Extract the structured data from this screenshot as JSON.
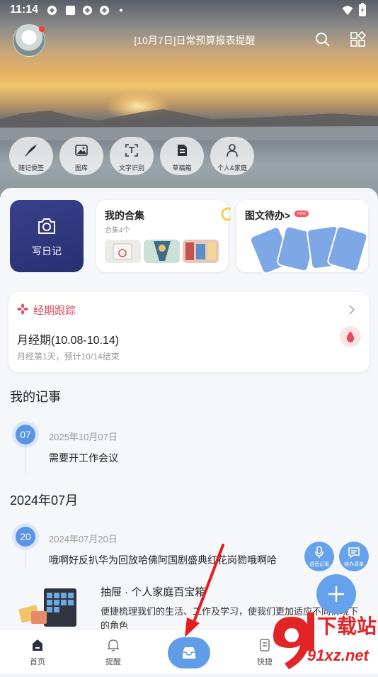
{
  "status": {
    "time": "11:14"
  },
  "header": {
    "title": "[10月7日]日常预算报表提醒"
  },
  "quick_actions": [
    {
      "label": "随记便签",
      "icon": "quill-icon"
    },
    {
      "label": "图库",
      "icon": "image-icon"
    },
    {
      "label": "文字识别",
      "icon": "scan-text-icon"
    },
    {
      "label": "草稿箱",
      "icon": "draft-box-icon"
    },
    {
      "label": "个人&家庭",
      "icon": "person-icon"
    }
  ],
  "write_diary": {
    "label": "写日记"
  },
  "collection": {
    "title": "我的合集",
    "count": "合集4个"
  },
  "todo": {
    "title": "图文待办>",
    "badge": "new"
  },
  "period": {
    "title": "经期跟踪",
    "main": "月经期(10.08-10.14)",
    "sub": "月经第1天，预计10/14结束"
  },
  "my_notes": {
    "title": "我的记事",
    "entries": [
      {
        "day": "07",
        "date": "2025年10月07日",
        "text": "需要开工作会议"
      }
    ]
  },
  "month_group": {
    "title": "2024年07月",
    "entries": [
      {
        "day": "20",
        "date": "2024年07月20日",
        "text": "哦啊好反扒华为回放哈佛阿国剧盛典红花岗勠哦啊哈"
      }
    ]
  },
  "book": {
    "title": "抽屉 · 个人家庭百宝箱",
    "desc_line1": "便捷梳理我们的生活、工作及学习，使我们更加适应不同情境下",
    "desc_line2": "的角色"
  },
  "fabs": {
    "voice": "语音记事",
    "todo": "待办清单"
  },
  "bottom_nav": [
    {
      "label": "首页"
    },
    {
      "label": "提醒"
    },
    {
      "label": "快捷"
    }
  ],
  "watermark": {
    "brand": "下载站",
    "url": "91xz.net"
  },
  "colors": {
    "accent": "#5f9ee7",
    "diary": "#2f377c",
    "period": "#e24b5c"
  }
}
